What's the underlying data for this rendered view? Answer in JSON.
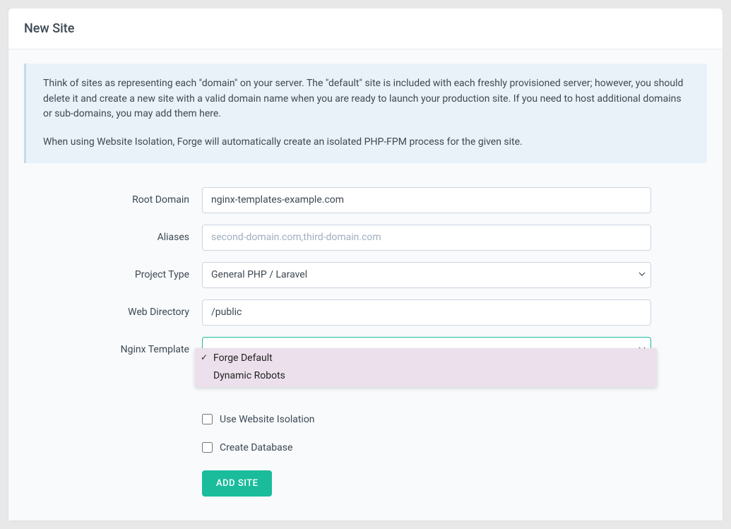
{
  "header": {
    "title": "New Site"
  },
  "info": {
    "p1": "Think of sites as representing each \"domain\" on your server. The \"default\" site is included with each freshly provisioned server; however, you should delete it and create a new site with a valid domain name when you are ready to launch your production site. If you need to host additional domains or sub-domains, you may add them here.",
    "p2": "When using Website Isolation, Forge will automatically create an isolated PHP-FPM process for the given site."
  },
  "form": {
    "root_domain": {
      "label": "Root Domain",
      "value": "nginx-templates-example.com"
    },
    "aliases": {
      "label": "Aliases",
      "placeholder": "second-domain.com,third-domain.com",
      "value": ""
    },
    "project_type": {
      "label": "Project Type",
      "selected": "General PHP / Laravel"
    },
    "web_directory": {
      "label": "Web Directory",
      "value": "/public"
    },
    "nginx_template": {
      "label": "Nginx Template",
      "options": [
        {
          "label": "Forge Default",
          "selected": true
        },
        {
          "label": "Dynamic Robots",
          "selected": false
        }
      ]
    },
    "use_isolation": {
      "label": "Use Website Isolation",
      "checked": false
    },
    "create_database": {
      "label": "Create Database",
      "checked": false
    },
    "submit_label": "ADD SITE"
  }
}
